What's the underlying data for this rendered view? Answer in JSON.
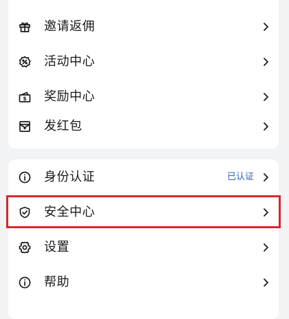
{
  "menu_group_1": {
    "items": [
      {
        "label": "邀请返佣",
        "icon": "gift-icon"
      },
      {
        "label": "活动中心",
        "icon": "activity-badge-icon"
      },
      {
        "label": "奖励中心",
        "icon": "reward-cash-icon"
      },
      {
        "label": "发红包",
        "icon": "red-envelope-icon"
      }
    ]
  },
  "menu_group_2": {
    "items": [
      {
        "label": "身份认证",
        "icon": "info-icon",
        "status": "已认证",
        "status_color": "#2f5fb8"
      },
      {
        "label": "安全中心",
        "icon": "shield-check-icon"
      },
      {
        "label": "设置",
        "icon": "gear-icon"
      },
      {
        "label": "帮助",
        "icon": "info-icon"
      }
    ]
  },
  "highlight": {
    "color": "#d7262b",
    "target": "安全中心"
  }
}
